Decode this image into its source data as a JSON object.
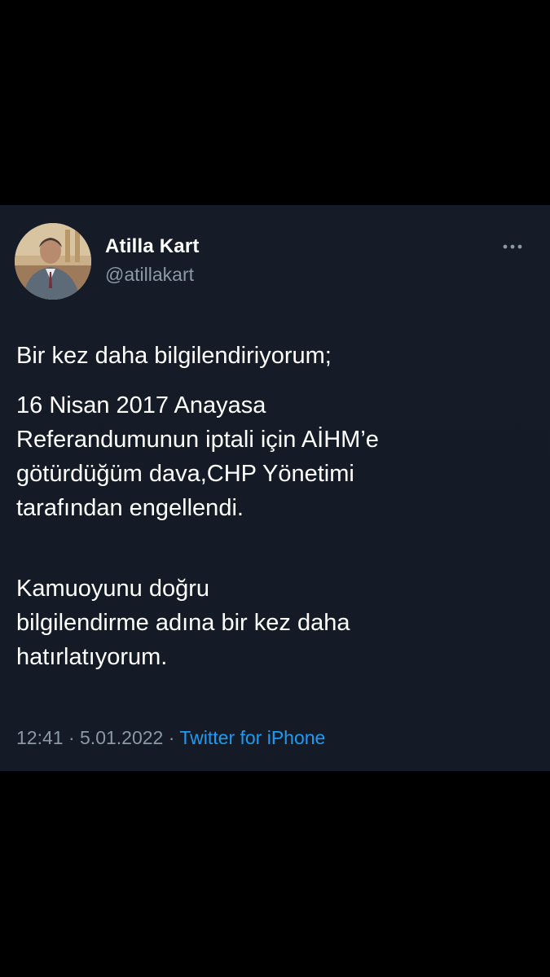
{
  "tweet": {
    "author": {
      "display_name": "Atilla Kart",
      "handle": "@atillakart",
      "avatar_icon": "profile-photo"
    },
    "more_icon": "more-horizontal-icon",
    "paragraphs": [
      [
        "Bir kez daha bilgilendiriyorum;"
      ],
      [
        "16 Nisan 2017 Anayasa",
        "Referandumunun iptali için AİHM’e",
        "götürdüğüm dava,CHP Yönetimi",
        "tarafından engellendi."
      ],
      [
        "Kamuoyunu doğru",
        "bilgilendirme adına bir kez daha",
        "hatırlatıyorum."
      ]
    ],
    "meta": {
      "time": "12:41",
      "separator": " · ",
      "date": "5.01.2022",
      "source": "Twitter for iPhone"
    }
  },
  "colors": {
    "background": "#000000",
    "card": "#161c27",
    "text": "#ffffff",
    "secondary": "#8b98a5",
    "link": "#1d9bf0"
  }
}
